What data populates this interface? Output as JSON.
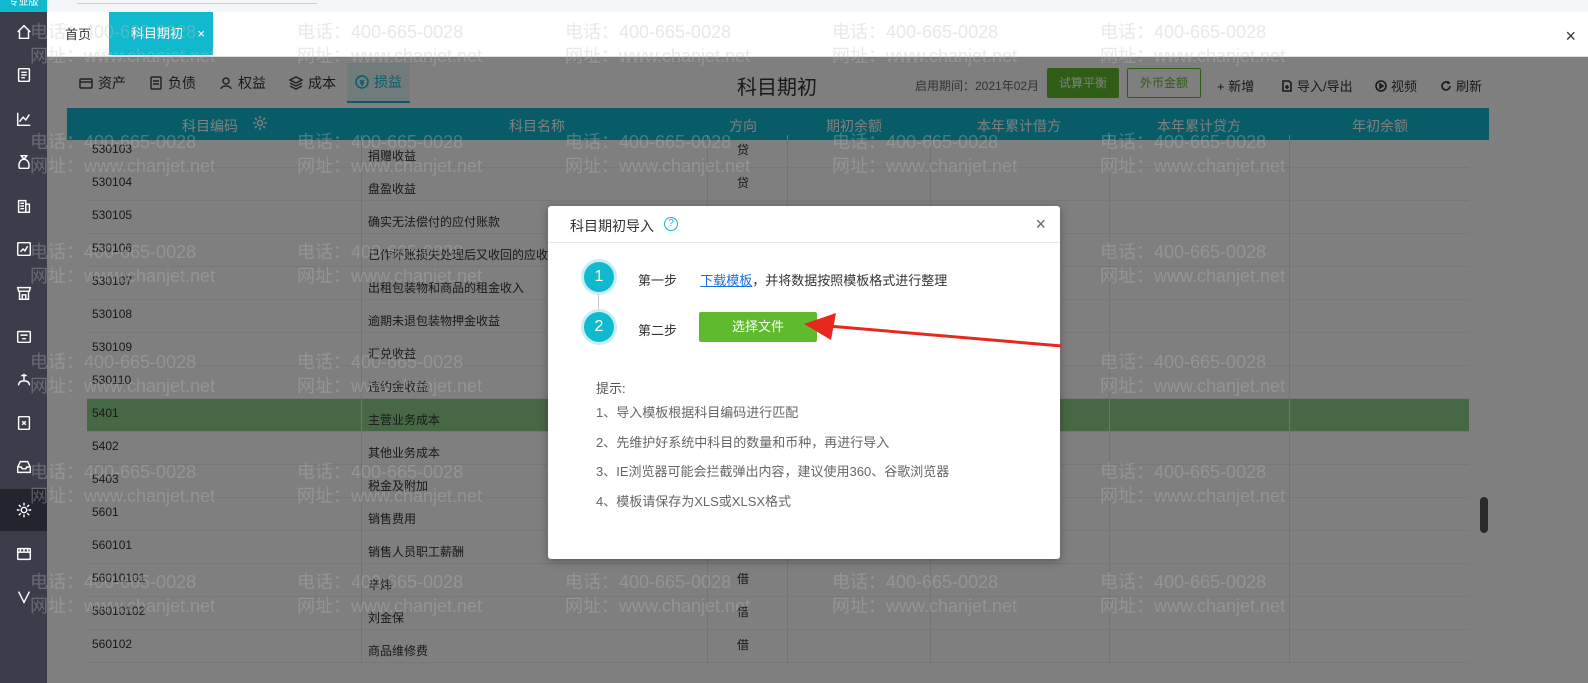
{
  "sidebar": {
    "logo_text": "专业版",
    "icons": [
      "home-icon",
      "voucher-icon",
      "chart-icon",
      "money-bag-icon",
      "building-icon",
      "report-icon",
      "store-icon",
      "cashier-icon",
      "payroll-icon",
      "invoice-icon",
      "inventory-icon",
      "settings-icon",
      "video-icon",
      "v-icon"
    ]
  },
  "tabs": {
    "home": "首页",
    "active": "科目期初",
    "active_close": "×"
  },
  "window_close": "×",
  "toolbar": {
    "categories": [
      "资产",
      "负债",
      "权益",
      "成本",
      "损益"
    ],
    "active_category": "损益",
    "title": "科目期初",
    "start_period": "启用期间：2021年02月",
    "trial_balance_button": "试算平衡",
    "fx_amount_button": "外币金额",
    "add_button": "+ 新增",
    "import_export_button": "导入/导出",
    "video_button": "视频",
    "refresh_button": "刷新"
  },
  "table": {
    "columns": [
      "科目编码",
      "科目名称",
      "方向",
      "期初余额",
      "本年累计借方",
      "本年累计贷方",
      "年初余额"
    ],
    "rows": [
      {
        "code": "530103",
        "name": "捐赠收益",
        "dir": "贷"
      },
      {
        "code": "530104",
        "name": "盘盈收益",
        "dir": "贷"
      },
      {
        "code": "530105",
        "name": "确实无法偿付的应付账款",
        "dir": ""
      },
      {
        "code": "530106",
        "name": "已作坏账损失处理后又收回的应收",
        "dir": ""
      },
      {
        "code": "530107",
        "name": "出租包装物和商品的租金收入",
        "dir": ""
      },
      {
        "code": "530108",
        "name": "逾期未退包装物押金收益",
        "dir": ""
      },
      {
        "code": "530109",
        "name": "汇兑收益",
        "dir": ""
      },
      {
        "code": "530110",
        "name": "违约金收益",
        "dir": ""
      },
      {
        "code": "5401",
        "name": "主营业务成本",
        "dir": ""
      },
      {
        "code": "5402",
        "name": "其他业务成本",
        "dir": ""
      },
      {
        "code": "5403",
        "name": "税金及附加",
        "dir": ""
      },
      {
        "code": "5601",
        "name": "销售费用",
        "dir": ""
      },
      {
        "code": "560101",
        "name": "销售人员职工薪酬",
        "dir": ""
      },
      {
        "code": "56010101",
        "name": "辛炜",
        "dir": "借"
      },
      {
        "code": "56010102",
        "name": "刘金保",
        "dir": "借"
      },
      {
        "code": "560102",
        "name": "商品维修费",
        "dir": "借"
      }
    ],
    "highlight_index": 8
  },
  "watermark": {
    "phone": "电话：400-665-0028",
    "site": "网址：www.chanjet.net"
  },
  "modal": {
    "title": "科目期初导入",
    "help": "?",
    "close": "×",
    "step1_num": "1",
    "step1_label": "第一步",
    "step1_link": "下载模板",
    "step1_text": "，并将数据按照模板格式进行整理",
    "step2_num": "2",
    "step2_label": "第二步",
    "choose_file_button": "选择文件",
    "tips_title": "提示:",
    "tips": [
      "1、导入模板根据科目编码进行匹配",
      "2、先维护好系统中科目的数量和币种，再进行导入",
      "3、IE浏览器可能会拦截弹出内容，建议使用360、谷歌浏览器",
      "4、模板请保存为XLS或XLSX格式"
    ]
  },
  "colors": {
    "accent": "#11b9cf",
    "green": "#5fbb2d",
    "sidebar": "#3b3e4a",
    "arrow": "#e8281e"
  }
}
